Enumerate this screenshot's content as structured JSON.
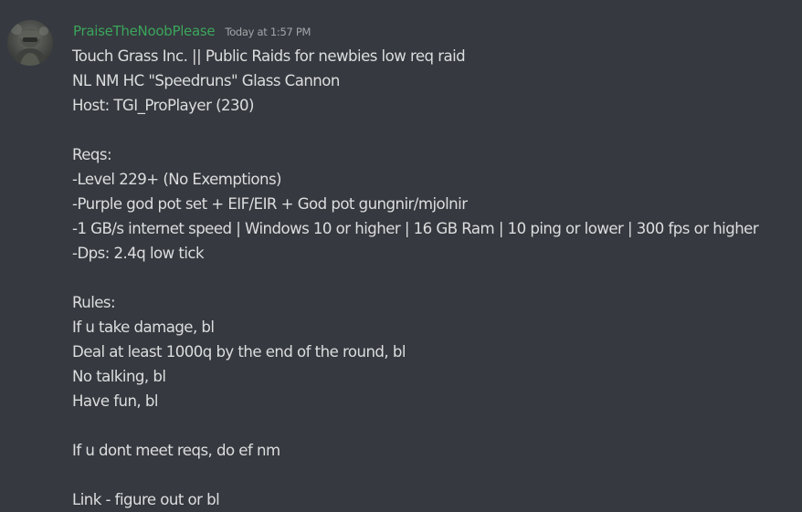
{
  "message": {
    "author": "PraiseTheNoobPlease",
    "timestamp": "Today at 1:57 PM",
    "author_color": "#3ba55c",
    "avatar_icon": "user-avatar-image",
    "lines": [
      "Touch Grass Inc. || Public Raids for newbies low req raid",
      "NL NM HC \"Speedruns\" Glass Cannon",
      "Host: TGI_ProPlayer (230)",
      "",
      "Reqs:",
      "-Level 229+ (No Exemptions)",
      "-Purple god pot set + EIF/EIR + God pot gungnir/mjolnir",
      "-1 GB/s internet speed | Windows 10 or higher | 16 GB Ram | 10 ping or lower | 300 fps or higher",
      "-Dps: 2.4q low tick",
      "",
      "Rules:",
      "If u take damage, bl",
      "Deal at least 1000q by the end of the round, bl",
      "No talking, bl",
      "Have fun, bl",
      "",
      "If u dont meet reqs, do ef nm",
      "",
      "Link - figure out or bl"
    ]
  }
}
